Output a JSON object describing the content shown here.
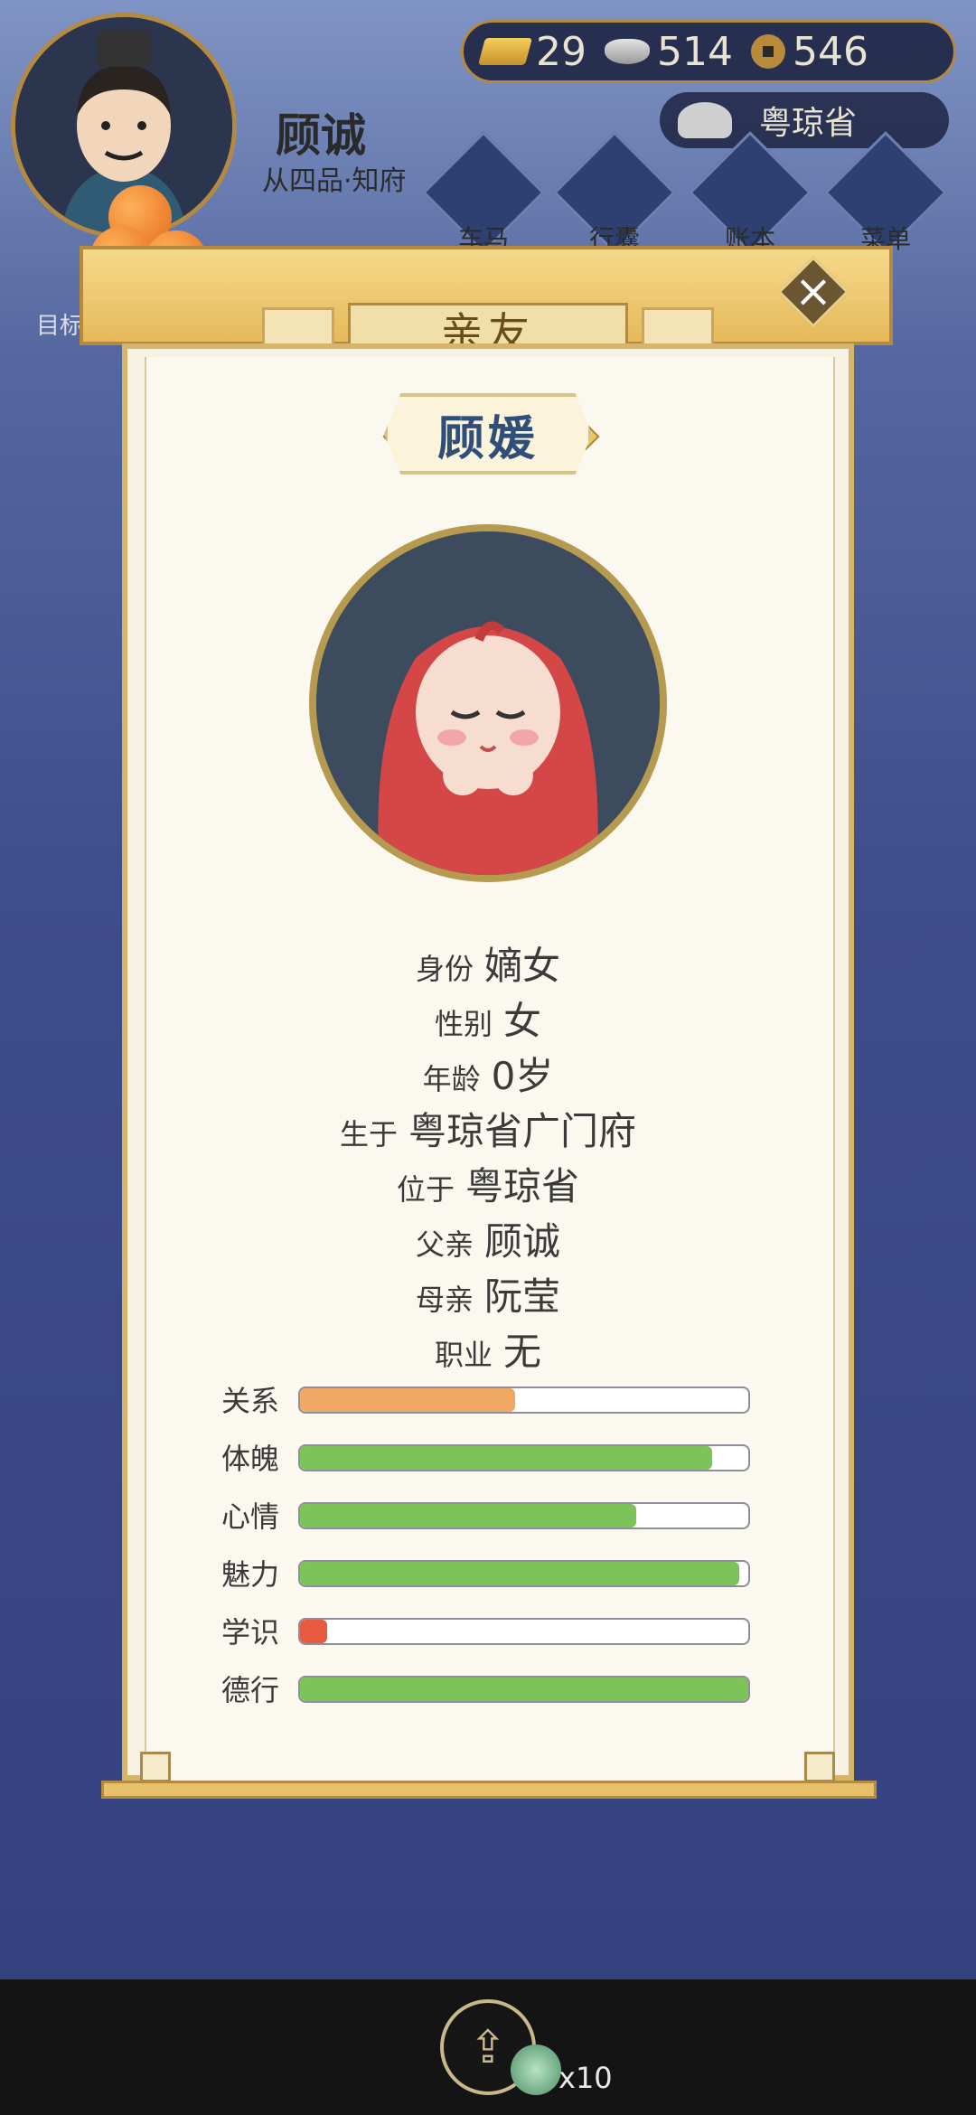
{
  "player": {
    "name": "顾诚",
    "rank": "从四品·知府"
  },
  "currency": {
    "gold": "29",
    "silver": "514",
    "coins": "546"
  },
  "location": {
    "province": "粤琼省"
  },
  "nav": [
    {
      "label": "车马",
      "icon": "carriage-icon"
    },
    {
      "label": "行囊",
      "icon": "bag-icon"
    },
    {
      "label": "账本",
      "icon": "ledger-icon"
    },
    {
      "label": "菜单",
      "icon": "menu-dots-icon"
    }
  ],
  "goal": {
    "label": "目标"
  },
  "dialog": {
    "title": "亲友",
    "person_name": "顾媛",
    "info": [
      {
        "key": "身份",
        "value": "嫡女"
      },
      {
        "key": "性别",
        "value": "女"
      },
      {
        "key": "年龄",
        "value": "0岁"
      },
      {
        "key": "生于",
        "value": "粤琼省广门府"
      },
      {
        "key": "位于",
        "value": "粤琼省"
      },
      {
        "key": "父亲",
        "value": "顾诚"
      },
      {
        "key": "母亲",
        "value": "阮莹"
      },
      {
        "key": "职业",
        "value": "无"
      }
    ],
    "stats": [
      {
        "label": "关系",
        "value": 0.48,
        "color": "#f2a865"
      },
      {
        "label": "体魄",
        "value": 0.92,
        "color": "#7cc35a"
      },
      {
        "label": "心情",
        "value": 0.75,
        "color": "#7cc35a"
      },
      {
        "label": "魅力",
        "value": 0.98,
        "color": "#7cc35a"
      },
      {
        "label": "学识",
        "value": 0.06,
        "color": "#e85a3f"
      },
      {
        "label": "德行",
        "value": 1.0,
        "color": "#7cc35a"
      }
    ]
  },
  "share": {
    "reward_count": "x10"
  }
}
